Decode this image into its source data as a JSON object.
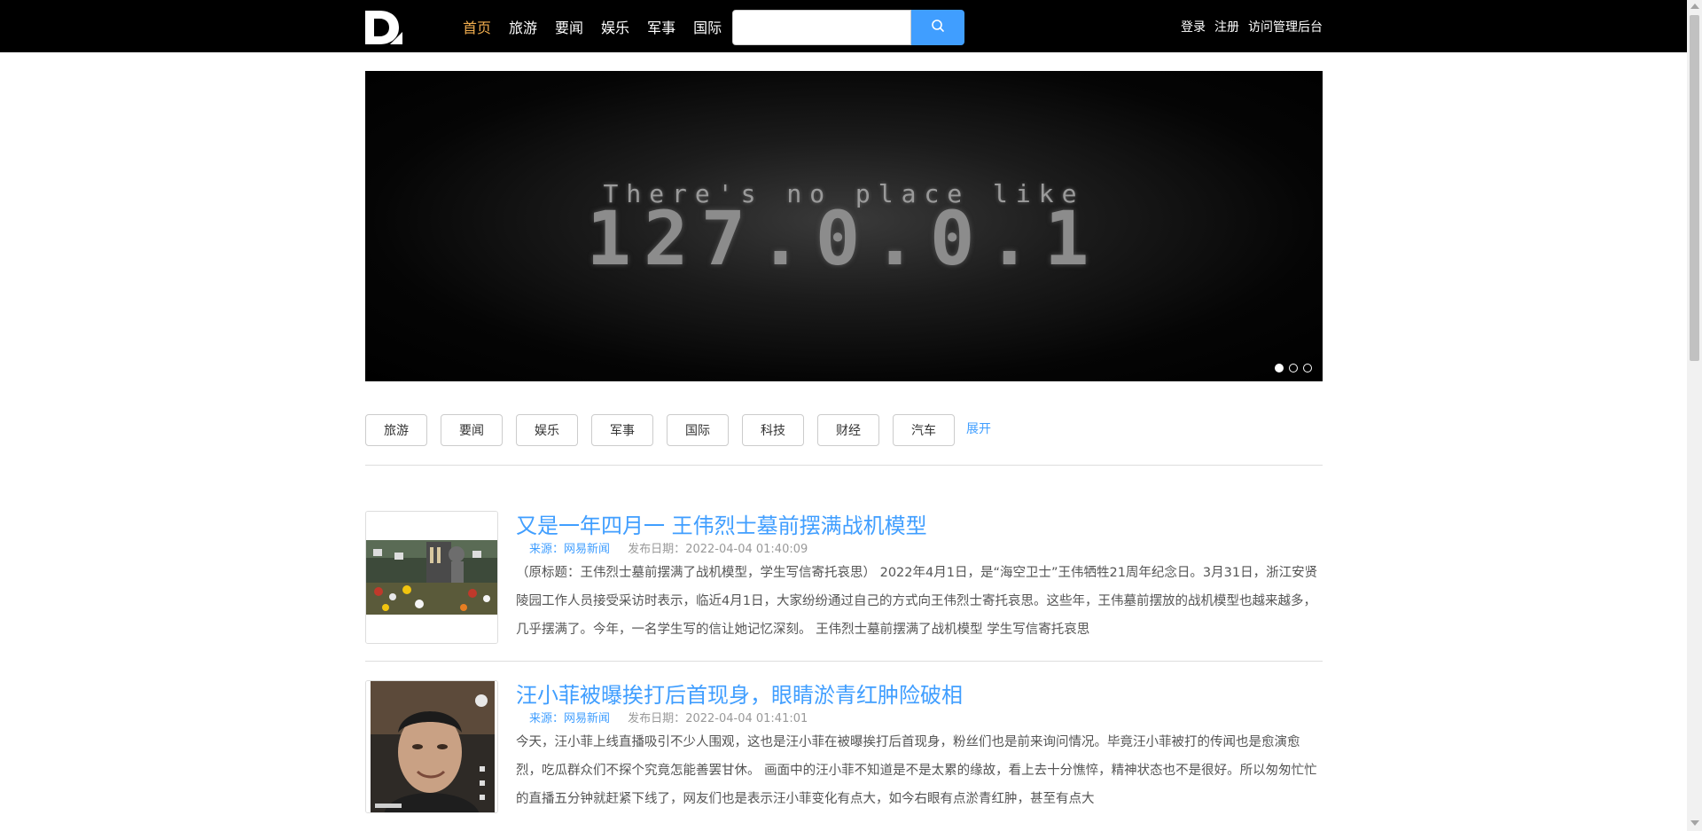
{
  "nav": {
    "items": [
      {
        "label": "首页",
        "active": true
      },
      {
        "label": "旅游"
      },
      {
        "label": "要闻"
      },
      {
        "label": "娱乐"
      },
      {
        "label": "军事"
      },
      {
        "label": "国际"
      }
    ],
    "search_placeholder": "",
    "account": {
      "login": "登录",
      "register": "注册",
      "admin": "访问管理后台"
    }
  },
  "banner": {
    "line1": "There's no place like",
    "line2": "127.0.0.1",
    "slides_total": 3,
    "active_slide": 1
  },
  "categories": {
    "items": [
      "旅游",
      "要闻",
      "娱乐",
      "军事",
      "国际",
      "科技",
      "财经",
      "汽车"
    ],
    "expand_label": "展开"
  },
  "news": [
    {
      "title": "又是一年四月一 王伟烈士墓前摆满战机模型",
      "source_label": "来源：",
      "source": "网易新闻",
      "date_label": "发布日期：",
      "date": "2022-04-04 01:40:09",
      "summary": "（原标题：王伟烈士墓前摆满了战机模型，学生写信寄托哀思） 2022年4月1日，是“海空卫士”王伟牺牲21周年纪念日。3月31日，浙江安贤陵园工作人员接受采访时表示，临近4月1日，大家纷纷通过自己的方式向王伟烈士寄托哀思。这些年，王伟墓前摆放的战机模型也越来越多，几乎摆满了。今年，一名学生写的信让她记忆深刻。 王伟烈士墓前摆满了战机模型 学生写信寄托哀思"
    },
    {
      "title": "汪小菲被曝挨打后首现身，眼睛淤青红肿险破相",
      "source_label": "来源：",
      "source": "网易新闻",
      "date_label": "发布日期：",
      "date": "2022-04-04 01:41:01",
      "summary": "今天，汪小菲上线直播吸引不少人围观，这也是汪小菲在被曝挨打后首现身，粉丝们也是前来询问情况。毕竟汪小菲被打的传闻也是愈演愈烈，吃瓜群众们不探个究竟怎能善罢甘休。 画面中的汪小菲不知道是不是太累的缘故，看上去十分憔悴，精神状态也不是很好。所以匆匆忙忙的直播五分钟就赶紧下线了，网友们也是表示汪小菲变化有点大，如今右眼有点淤青红肿，甚至有点大"
    }
  ],
  "colors": {
    "topbar": "#000000",
    "accent": "#409eff",
    "active_nav": "#f0ad4e"
  }
}
